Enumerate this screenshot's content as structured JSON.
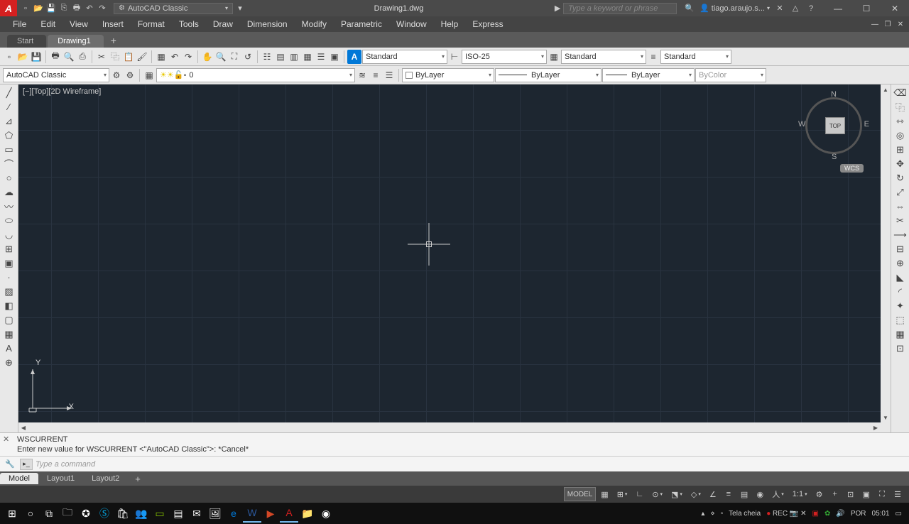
{
  "title": "Drawing1.dwg",
  "workspace": "AutoCAD Classic",
  "search_placeholder": "Type a keyword or phrase",
  "user": "tiago.araujo.s...",
  "menu": [
    "File",
    "Edit",
    "View",
    "Insert",
    "Format",
    "Tools",
    "Draw",
    "Dimension",
    "Modify",
    "Parametric",
    "Window",
    "Help",
    "Express"
  ],
  "doctabs": {
    "start": "Start",
    "active": "Drawing1"
  },
  "styles": {
    "text": "Standard",
    "dim": "ISO-25",
    "table": "Standard",
    "ml": "Standard"
  },
  "layer": {
    "current": "0",
    "ws": "AutoCAD Classic"
  },
  "props": {
    "color": "ByLayer",
    "ltype": "ByLayer",
    "lweight": "ByLayer",
    "plot": "ByColor"
  },
  "viewport": "[−][Top][2D Wireframe]",
  "viewcube": {
    "face": "TOP",
    "n": "N",
    "s": "S",
    "e": "E",
    "w": "W",
    "cs": "WCS"
  },
  "ucs": {
    "x": "X",
    "y": "Y"
  },
  "cmd": {
    "hist1": "WSCURRENT",
    "hist2": "Enter new value for WSCURRENT <\"AutoCAD Classic\">: *Cancel*",
    "placeholder": "Type a command"
  },
  "layout_tabs": {
    "model": "Model",
    "l1": "Layout1",
    "l2": "Layout2"
  },
  "status": {
    "model": "MODEL",
    "scale": "1:1"
  },
  "tray": {
    "label": "Tela cheia",
    "rec": "REC",
    "lang": "POR",
    "time": "05:01"
  }
}
